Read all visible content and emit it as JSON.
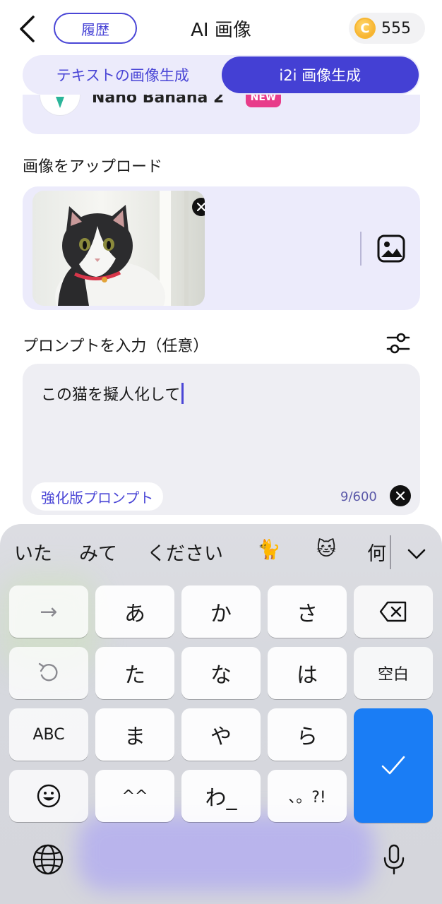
{
  "header": {
    "history_label": "履歴",
    "title": "AI 画像",
    "coin_symbol": "C",
    "coin_count": "555"
  },
  "tabs": [
    {
      "label": "テキストの画像生成",
      "active": false
    },
    {
      "label": "i2i 画像生成",
      "active": true
    }
  ],
  "model": {
    "name": "Nano Banana 2",
    "badge": "NEW"
  },
  "upload": {
    "label": "画像をアップロード"
  },
  "prompt": {
    "label": "プロンプトを入力（任意）",
    "value": "この猫を擬人化して",
    "enhance_label": "強化版プロンプト",
    "counter": "9/600"
  },
  "keyboard": {
    "suggestions": [
      "いた",
      "みて",
      "ください",
      "🐈",
      "🐱",
      "何"
    ],
    "rows": [
      [
        "→",
        "あ",
        "か",
        "さ",
        "⌫"
      ],
      [
        "↺",
        "た",
        "な",
        "は",
        "空白"
      ],
      [
        "ABC",
        "ま",
        "や",
        "ら",
        "✓"
      ],
      [
        "☺",
        "^^",
        "わ_",
        "、。?!"
      ]
    ],
    "space_label": "空白",
    "abc_label": "ABC",
    "punct_label": "、。?!",
    "confirm_color": "#1a7df5"
  },
  "colors": {
    "accent": "#4440d4",
    "card_bg": "#ecebfb",
    "prompt_bg": "#eeeef3"
  }
}
